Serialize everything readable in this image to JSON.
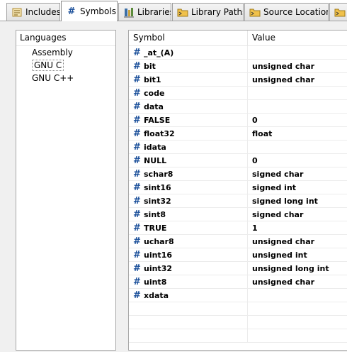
{
  "tabs": [
    {
      "label": "Includes",
      "icon": "includes-icon"
    },
    {
      "label": "Symbols",
      "icon": "hash-icon",
      "active": true
    },
    {
      "label": "Libraries",
      "icon": "libraries-icon"
    },
    {
      "label": "Library Paths",
      "icon": "folder-icon"
    },
    {
      "label": "Source Location",
      "icon": "folder-icon"
    },
    {
      "label": "",
      "icon": "folder-icon"
    }
  ],
  "languages": {
    "header": "Languages",
    "items": [
      "Assembly",
      "GNU C",
      "GNU C++"
    ],
    "selected": 1
  },
  "symbols": {
    "columns": {
      "symbol": "Symbol",
      "value": "Value"
    },
    "hash_glyph": "#",
    "rows": [
      {
        "symbol": "_at_(A)",
        "value": ""
      },
      {
        "symbol": "bit",
        "value": "unsigned char"
      },
      {
        "symbol": "bit1",
        "value": "unsigned char"
      },
      {
        "symbol": "code",
        "value": ""
      },
      {
        "symbol": "data",
        "value": ""
      },
      {
        "symbol": "FALSE",
        "value": "0"
      },
      {
        "symbol": "float32",
        "value": "float"
      },
      {
        "symbol": "idata",
        "value": ""
      },
      {
        "symbol": "NULL",
        "value": "0"
      },
      {
        "symbol": "schar8",
        "value": "signed char"
      },
      {
        "symbol": "sint16",
        "value": "signed int"
      },
      {
        "symbol": "sint32",
        "value": "signed long int"
      },
      {
        "symbol": "sint8",
        "value": "signed char"
      },
      {
        "symbol": "TRUE",
        "value": "1"
      },
      {
        "symbol": "uchar8",
        "value": "unsigned char"
      },
      {
        "symbol": "uint16",
        "value": "unsigned int"
      },
      {
        "symbol": "uint32",
        "value": "unsigned long int"
      },
      {
        "symbol": "uint8",
        "value": "unsigned char"
      },
      {
        "symbol": "xdata",
        "value": ""
      }
    ]
  },
  "colors": {
    "hash": "#1a4f9a",
    "folder": "#d9a73a",
    "border": "#a7a7a7"
  }
}
